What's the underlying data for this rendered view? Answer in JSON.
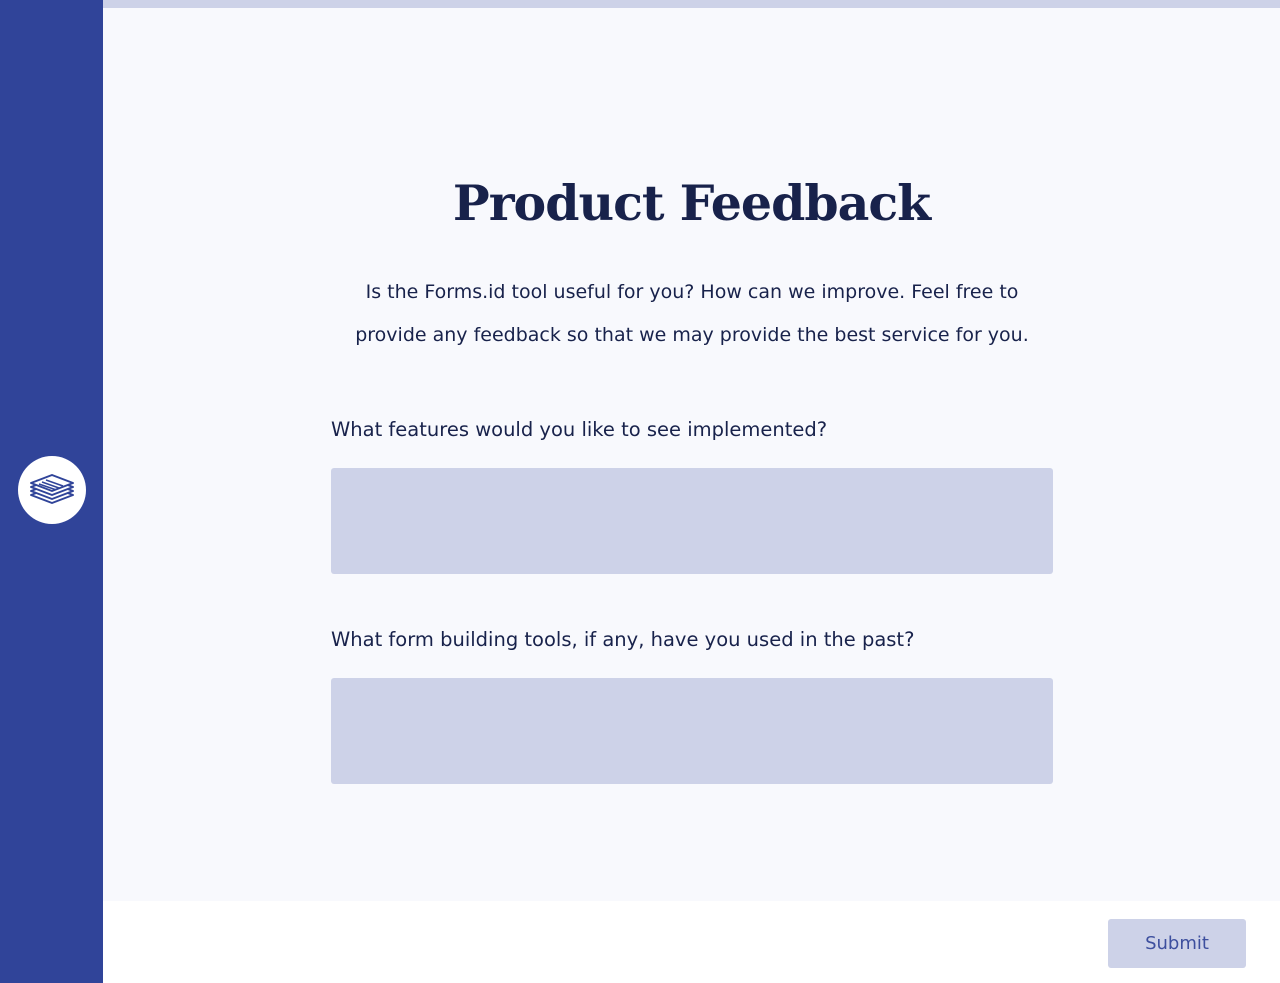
{
  "sidebar": {
    "logo_icon": "stacked-documents-icon"
  },
  "form": {
    "title": "Product Feedback",
    "description": "Is the Forms.id tool useful for you? How can we improve. Feel free to provide any feedback so that we may provide the best service for you.",
    "questions": [
      {
        "label": "What features would you like to see implemented?",
        "value": ""
      },
      {
        "label": "What form building tools, if any, have you used in the past?",
        "value": ""
      }
    ]
  },
  "footer": {
    "submit_label": "Submit"
  },
  "colors": {
    "sidebar": "#304499",
    "accent_light": "#cdd2e8",
    "background": "#f8f9fd",
    "text": "#18224b",
    "button_text": "#3d4f9e"
  }
}
